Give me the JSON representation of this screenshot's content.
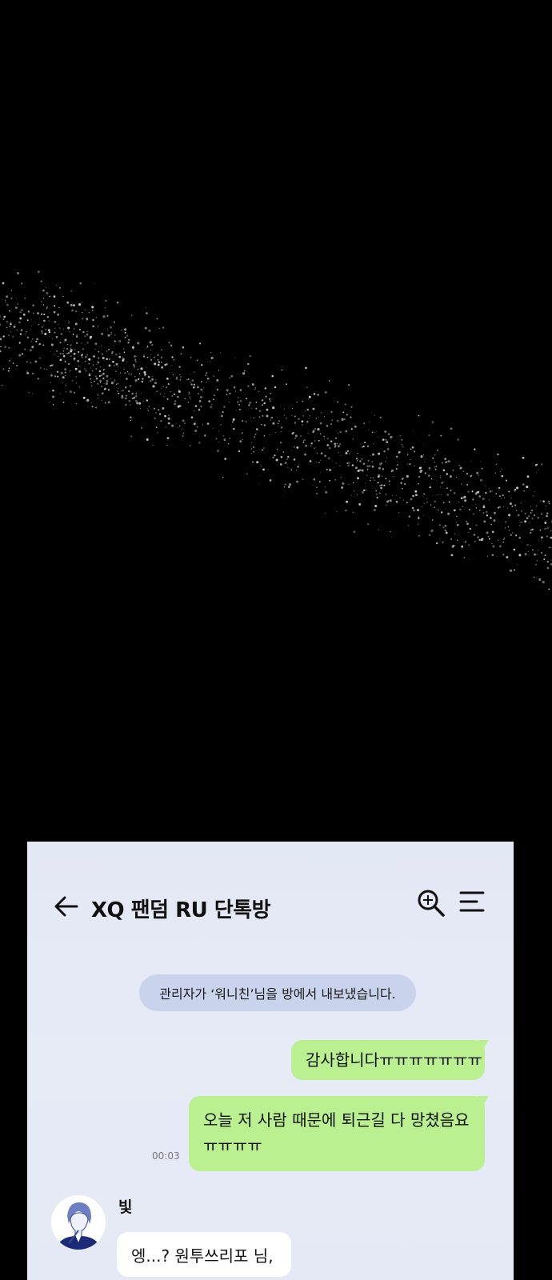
{
  "header": {
    "title": "XQ 팬덤 RU 단톡방",
    "back_icon": "arrow-left-icon",
    "search_icon": "search-zoom-icon",
    "menu_icon": "menu-icon"
  },
  "system_notice": "관리자가 ‘워니친’님을 방에서 내보냈습니다.",
  "messages": [
    {
      "direction": "outgoing",
      "text": "감사합니다ㅠㅠㅠㅠㅠㅠㅠ"
    },
    {
      "direction": "outgoing",
      "text": "오늘 저 사람 때문에 퇴근길 다 망쳤음요 ㅠㅠㅠㅠ",
      "time": "00:03"
    },
    {
      "direction": "incoming",
      "sender": "빛",
      "avatar_icon": "avatar-illustration",
      "text": "엥...? 원투쓰리포 님,"
    }
  ],
  "colors": {
    "outgoing_bubble": "#baf090",
    "incoming_bubble": "#ffffff",
    "notice_bg": "#c9d4ec",
    "chat_bg": "#e5e9f5",
    "scene_bg": "#000000",
    "sparkle": "#cfcfcf"
  }
}
